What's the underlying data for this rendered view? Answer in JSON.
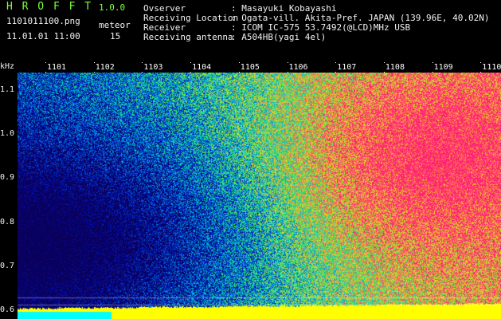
{
  "header": {
    "app_name": "H R O F F T",
    "version": "1.0.0",
    "filename": "1101011100.png",
    "datetime": "11.01.01 11:00",
    "meteor_label": "meteor",
    "meteor_count": "15",
    "info": [
      {
        "key": "Ovserver",
        "value": ": Masayuki Kobayashi"
      },
      {
        "key": "Receiving Location",
        "value": ": Ogata-vill. Akita-Pref. JAPAN (139.96E, 40.02N)"
      },
      {
        "key": "Receiver",
        "value": ": ICOM IC-575 53.7492(@LCD)MHz USB"
      },
      {
        "key": "Receiving antenna",
        "value": ": A504HB(yagi 4el)"
      }
    ]
  },
  "colors": {
    "header_green": "#7dff3a",
    "text_white": "#f2f2f2",
    "background": "#000000"
  },
  "chart_data": {
    "type": "heatmap",
    "ylabel": "kHz",
    "ylim": [
      0.58,
      1.14
    ],
    "yticks": [
      "1.1",
      "1.0",
      "0.9",
      "0.8",
      "0.7",
      "0.6"
    ],
    "xticks": [
      "1101",
      "1102",
      "1103",
      "1104",
      "1105",
      "1106",
      "1107",
      "1108",
      "1109",
      "1110"
    ]
  }
}
